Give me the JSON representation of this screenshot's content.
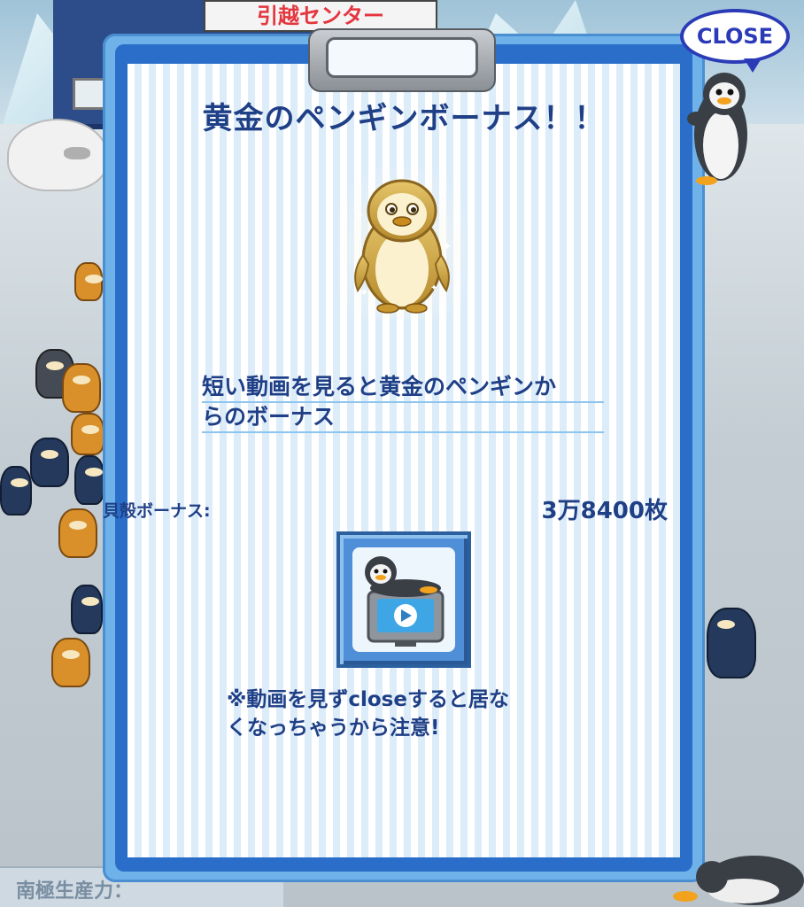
{
  "background": {
    "sign_text": "引越センター",
    "status_label": "南極生産力："
  },
  "close_button": {
    "label": "CLOSE"
  },
  "dialog": {
    "title": "黄金のペンギンボーナス！！",
    "description_lines": [
      "短い動画を見ると黄金のペンギンか",
      "らのボーナス"
    ],
    "bonus": {
      "label": "貝殻ボーナス:",
      "value": "3万8400枚"
    },
    "video_button": {
      "icon": "penguin-on-tv-play-icon"
    },
    "warning_lines": [
      "※動画を見ずcloseすると居な",
      "くなっちゃうから注意!"
    ]
  },
  "colors": {
    "text_primary": "#1f3f86",
    "board_blue": "#2b6ec9",
    "close_blue": "#2b3bb8",
    "gold": "#d9b24a"
  }
}
